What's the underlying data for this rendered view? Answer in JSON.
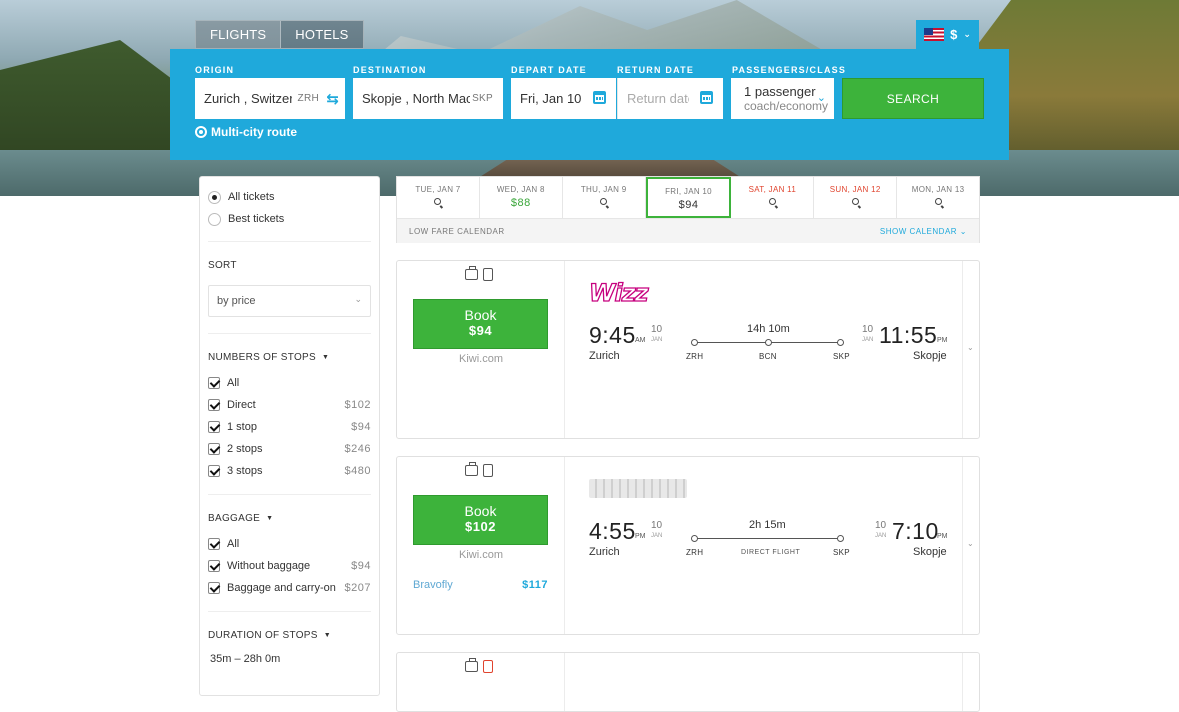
{
  "tabs": [
    {
      "label": "FLIGHTS"
    },
    {
      "label": "HOTELS"
    }
  ],
  "currency": {
    "symbol": "$"
  },
  "search": {
    "origin": {
      "label": "ORIGIN",
      "value": "Zurich , Switzerland",
      "code": "ZRH"
    },
    "destination": {
      "label": "DESTINATION",
      "value": "Skopje , North Macedonia",
      "code": "SKP"
    },
    "depart": {
      "label": "DEPART DATE",
      "value": "Fri, Jan 10"
    },
    "return": {
      "label": "RETURN DATE",
      "placeholder": "Return date"
    },
    "passengers": {
      "label": "PASSENGERS/CLASS",
      "value": "1 passenger",
      "class": "coach/economy"
    },
    "button": "SEARCH",
    "multi_city": "Multi-city route"
  },
  "filters": {
    "ticket_types": [
      {
        "label": "All tickets",
        "selected": true
      },
      {
        "label": "Best tickets",
        "selected": false
      }
    ],
    "sort_title": "SORT",
    "sort_value": "by price",
    "stops_title": "NUMBERS OF STOPS",
    "stops": [
      {
        "label": "All",
        "price": ""
      },
      {
        "label": "Direct",
        "price": "$102"
      },
      {
        "label": "1 stop",
        "price": "$94"
      },
      {
        "label": "2 stops",
        "price": "$246"
      },
      {
        "label": "3 stops",
        "price": "$480"
      }
    ],
    "baggage_title": "BAGGAGE",
    "baggage": [
      {
        "label": "All",
        "price": ""
      },
      {
        "label": "Without baggage",
        "price": "$94"
      },
      {
        "label": "Baggage and carry-on",
        "price": "$207"
      }
    ],
    "duration_title": "DURATION OF STOPS",
    "duration_range": "35m – 28h 0m"
  },
  "dates": [
    {
      "label": "TUE, JAN 7",
      "value": "",
      "weekend": false
    },
    {
      "label": "WED, JAN 8",
      "value": "$88",
      "weekend": false
    },
    {
      "label": "THU, JAN 9",
      "value": "",
      "weekend": false
    },
    {
      "label": "FRI, JAN 10",
      "value": "$94",
      "weekend": false
    },
    {
      "label": "SAT, JAN 11",
      "value": "",
      "weekend": true
    },
    {
      "label": "SUN, JAN 12",
      "value": "",
      "weekend": true
    },
    {
      "label": "MON, JAN 13",
      "value": "",
      "weekend": false
    }
  ],
  "low_fare": {
    "label": "LOW FARE CALENDAR",
    "action": "SHOW CALENDAR"
  },
  "results": [
    {
      "book": "Book",
      "price": "$94",
      "provider": "Kiwi.com",
      "airline": "Wizz",
      "dep_time": "9:45",
      "dep_ampm": "AM",
      "dep_day": "10",
      "dep_mon": "JAN",
      "dep_city": "Zurich",
      "arr_time": "11:55",
      "arr_ampm": "PM",
      "arr_day": "10",
      "arr_mon": "JAN",
      "arr_city": "Skopje",
      "duration": "14h 10m",
      "codes": [
        "ZRH",
        "BCN",
        "SKP"
      ]
    },
    {
      "book": "Book",
      "price": "$102",
      "provider": "Kiwi.com",
      "alt_provider": "Bravofly",
      "alt_price": "$117",
      "dep_time": "4:55",
      "dep_ampm": "PM",
      "dep_day": "10",
      "dep_mon": "JAN",
      "dep_city": "Zurich",
      "arr_time": "7:10",
      "arr_ampm": "PM",
      "arr_day": "10",
      "arr_mon": "JAN",
      "arr_city": "Skopje",
      "duration": "2h 15m",
      "direct_label": "DIRECT FLIGHT",
      "codes": [
        "ZRH",
        "SKP"
      ]
    }
  ]
}
